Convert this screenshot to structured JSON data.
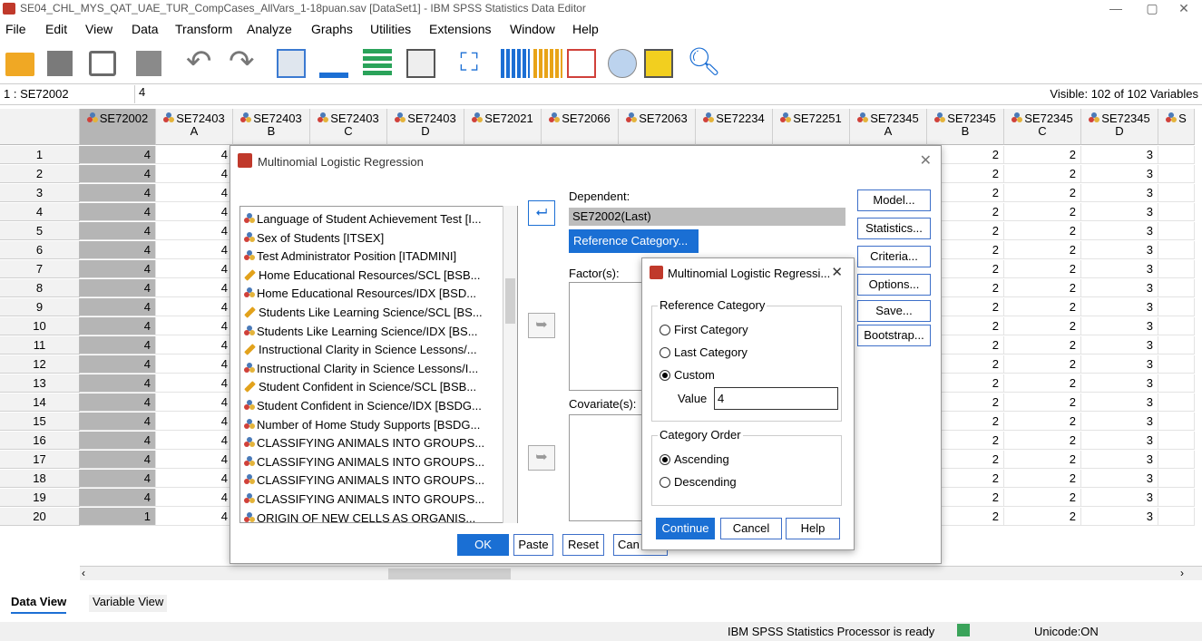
{
  "titlebar": {
    "title": "SE04_CHL_MYS_QAT_UAE_TUR_CompCases_AllVars_1-18puan.sav [DataSet1] - IBM SPSS Statistics Data Editor",
    "min": "—",
    "max": "▢",
    "close": "✕"
  },
  "menu": [
    "File",
    "Edit",
    "View",
    "Data",
    "Transform",
    "Analyze",
    "Graphs",
    "Utilities",
    "Extensions",
    "Window",
    "Help"
  ],
  "cellbar": {
    "ref": "1 : SE72002",
    "value": "4",
    "visible": "Visible: 102 of 102 Variables"
  },
  "columns": [
    {
      "l1": "SE72002",
      "l2": ""
    },
    {
      "l1": "SE72403",
      "l2": "A"
    },
    {
      "l1": "SE72403",
      "l2": "B"
    },
    {
      "l1": "SE72403",
      "l2": "C"
    },
    {
      "l1": "SE72403",
      "l2": "D"
    },
    {
      "l1": "SE72021",
      "l2": ""
    },
    {
      "l1": "SE72066",
      "l2": ""
    },
    {
      "l1": "SE72063",
      "l2": ""
    },
    {
      "l1": "SE72234",
      "l2": ""
    },
    {
      "l1": "SE72251",
      "l2": ""
    },
    {
      "l1": "SE72345",
      "l2": "A"
    },
    {
      "l1": "SE72345",
      "l2": "B"
    },
    {
      "l1": "SE72345",
      "l2": "C"
    },
    {
      "l1": "SE72345",
      "l2": "D"
    },
    {
      "l1": "S",
      "l2": ""
    }
  ],
  "rows": [
    {
      "n": "1",
      "c0": "4",
      "c1": "4",
      "c11": "2",
      "c12": "2",
      "c13": "3"
    },
    {
      "n": "2",
      "c0": "4",
      "c1": "4",
      "c11": "2",
      "c12": "2",
      "c13": "3"
    },
    {
      "n": "3",
      "c0": "4",
      "c1": "4",
      "c11": "2",
      "c12": "2",
      "c13": "3"
    },
    {
      "n": "4",
      "c0": "4",
      "c1": "4",
      "c11": "2",
      "c12": "2",
      "c13": "3"
    },
    {
      "n": "5",
      "c0": "4",
      "c1": "4",
      "c11": "2",
      "c12": "2",
      "c13": "3"
    },
    {
      "n": "6",
      "c0": "4",
      "c1": "4",
      "c11": "2",
      "c12": "2",
      "c13": "3"
    },
    {
      "n": "7",
      "c0": "4",
      "c1": "4",
      "c11": "2",
      "c12": "2",
      "c13": "3"
    },
    {
      "n": "8",
      "c0": "4",
      "c1": "4",
      "c11": "2",
      "c12": "2",
      "c13": "3"
    },
    {
      "n": "9",
      "c0": "4",
      "c1": "4",
      "c11": "2",
      "c12": "2",
      "c13": "3"
    },
    {
      "n": "10",
      "c0": "4",
      "c1": "4",
      "c11": "2",
      "c12": "2",
      "c13": "3"
    },
    {
      "n": "11",
      "c0": "4",
      "c1": "4",
      "c11": "2",
      "c12": "2",
      "c13": "3"
    },
    {
      "n": "12",
      "c0": "4",
      "c1": "4",
      "c11": "2",
      "c12": "2",
      "c13": "3"
    },
    {
      "n": "13",
      "c0": "4",
      "c1": "4",
      "c11": "2",
      "c12": "2",
      "c13": "3"
    },
    {
      "n": "14",
      "c0": "4",
      "c1": "4",
      "c11": "2",
      "c12": "2",
      "c13": "3"
    },
    {
      "n": "15",
      "c0": "4",
      "c1": "4",
      "c11": "2",
      "c12": "2",
      "c13": "3"
    },
    {
      "n": "16",
      "c0": "4",
      "c1": "4",
      "c11": "2",
      "c12": "2",
      "c13": "3"
    },
    {
      "n": "17",
      "c0": "4",
      "c1": "4",
      "c11": "2",
      "c12": "2",
      "c13": "3"
    },
    {
      "n": "18",
      "c0": "4",
      "c1": "4",
      "c11": "2",
      "c12": "2",
      "c13": "3"
    },
    {
      "n": "19",
      "c0": "4",
      "c1": "4",
      "c11": "2",
      "c12": "2",
      "c13": "3"
    },
    {
      "n": "20",
      "c0": "1",
      "c1": "4",
      "c11": "2",
      "c12": "2",
      "c13": "3"
    }
  ],
  "tabs": {
    "data_view": "Data View",
    "variable_view": "Variable View"
  },
  "status": {
    "processor": "IBM SPSS Statistics Processor is ready",
    "unicode": "Unicode:ON"
  },
  "dialog": {
    "title": "Multinomial Logistic Regression",
    "variables": [
      {
        "t": "nom",
        "label": "Language of Student Achievement Test [I..."
      },
      {
        "t": "nom",
        "label": "Sex of Students [ITSEX]"
      },
      {
        "t": "nom",
        "label": "Test Administrator Position [ITADMINI]"
      },
      {
        "t": "scale",
        "label": "Home Educational Resources/SCL [BSB..."
      },
      {
        "t": "nom",
        "label": "Home Educational Resources/IDX [BSD..."
      },
      {
        "t": "scale",
        "label": "Students Like Learning Science/SCL [BS..."
      },
      {
        "t": "nom",
        "label": "Students Like Learning Science/IDX [BS..."
      },
      {
        "t": "scale",
        "label": "Instructional Clarity in Science Lessons/..."
      },
      {
        "t": "nom",
        "label": "Instructional Clarity in Science Lessons/I..."
      },
      {
        "t": "scale",
        "label": "Student Confident in Science/SCL [BSB..."
      },
      {
        "t": "nom",
        "label": "Student Confident in Science/IDX [BSDG..."
      },
      {
        "t": "nom",
        "label": "Number of Home Study Supports [BSDG..."
      },
      {
        "t": "nom",
        "label": "CLASSIFYING ANIMALS INTO GROUPS..."
      },
      {
        "t": "nom",
        "label": "CLASSIFYING ANIMALS INTO GROUPS..."
      },
      {
        "t": "nom",
        "label": "CLASSIFYING ANIMALS INTO GROUPS..."
      },
      {
        "t": "nom",
        "label": "CLASSIFYING ANIMALS INTO GROUPS..."
      },
      {
        "t": "nom",
        "label": "ORIGIN OF NEW CELLS AS ORGANIS..."
      }
    ],
    "dependent_label": "Dependent:",
    "dependent_value": "SE72002(Last)",
    "reference_button": "Reference Category...",
    "factors_label": "Factor(s):",
    "covariates_label": "Covariate(s):",
    "side_buttons": [
      "Model...",
      "Statistics...",
      "Criteria...",
      "Options...",
      "Save...",
      "Bootstrap..."
    ],
    "bottom_buttons": {
      "ok": "OK",
      "paste": "Paste",
      "reset": "Reset",
      "cancel": "Can",
      "help": ""
    }
  },
  "subdialog": {
    "title": "Multinomial Logistic Regressi...",
    "ref_group": "Reference Category",
    "first": "First Category",
    "last": "Last Category",
    "custom": "Custom",
    "value_label": "Value",
    "value": "4",
    "order_group": "Category Order",
    "ascending": "Ascending",
    "descending": "Descending",
    "continue": "Continue",
    "cancel": "Cancel",
    "help": "Help"
  }
}
